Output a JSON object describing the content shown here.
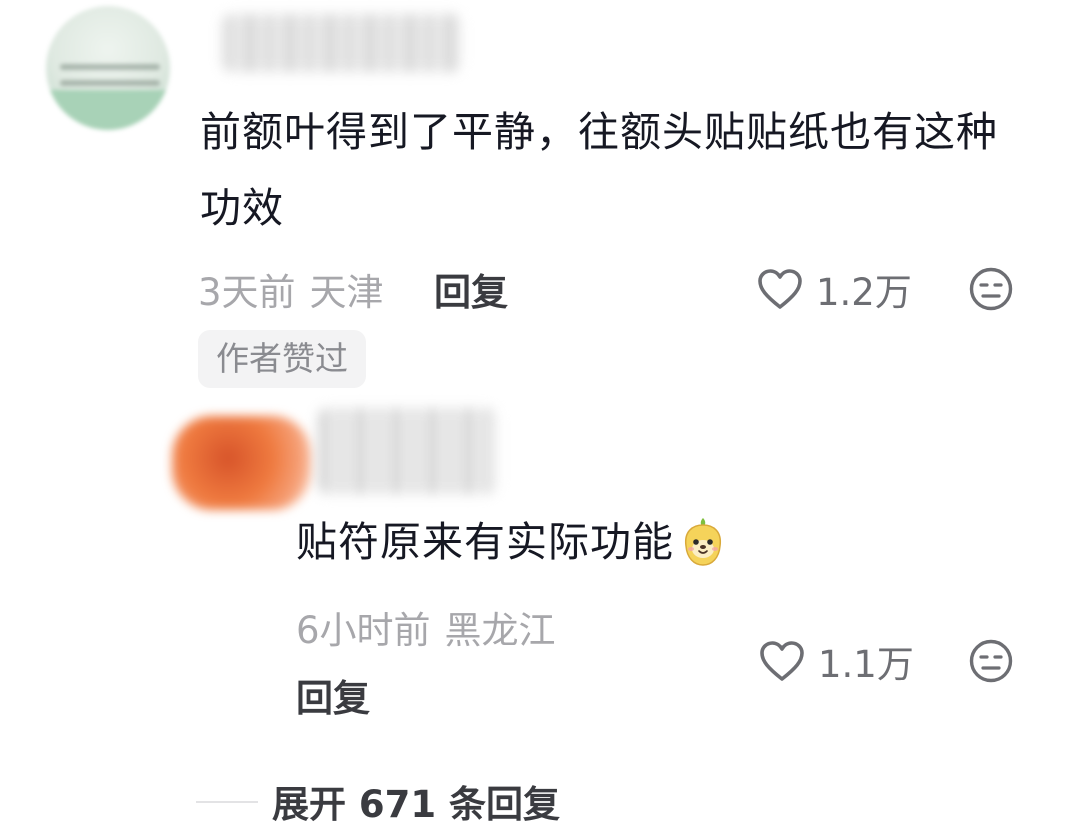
{
  "top_comment": {
    "text": "前额叶得到了平静，往额头贴贴纸也有这种功效",
    "time": "3天前",
    "location": "天津",
    "reply_label": "回复",
    "like_count": "1.2万",
    "author_liked_label": "作者赞过"
  },
  "reply_comment": {
    "text": "贴符原来有实际功能",
    "time": "6小时前",
    "location": "黑龙江",
    "reply_label": "回复",
    "like_count": "1.1万"
  },
  "expand": {
    "label": "展开 671 条回复"
  },
  "icons": {
    "like": "heart-outline-icon",
    "dislike": "meh-face-icon",
    "emoji": "cute-face-emoji"
  },
  "colors": {
    "primary_text": "#161823",
    "secondary_text": "#a7a7ab",
    "icon_gray": "#6d6e73"
  }
}
